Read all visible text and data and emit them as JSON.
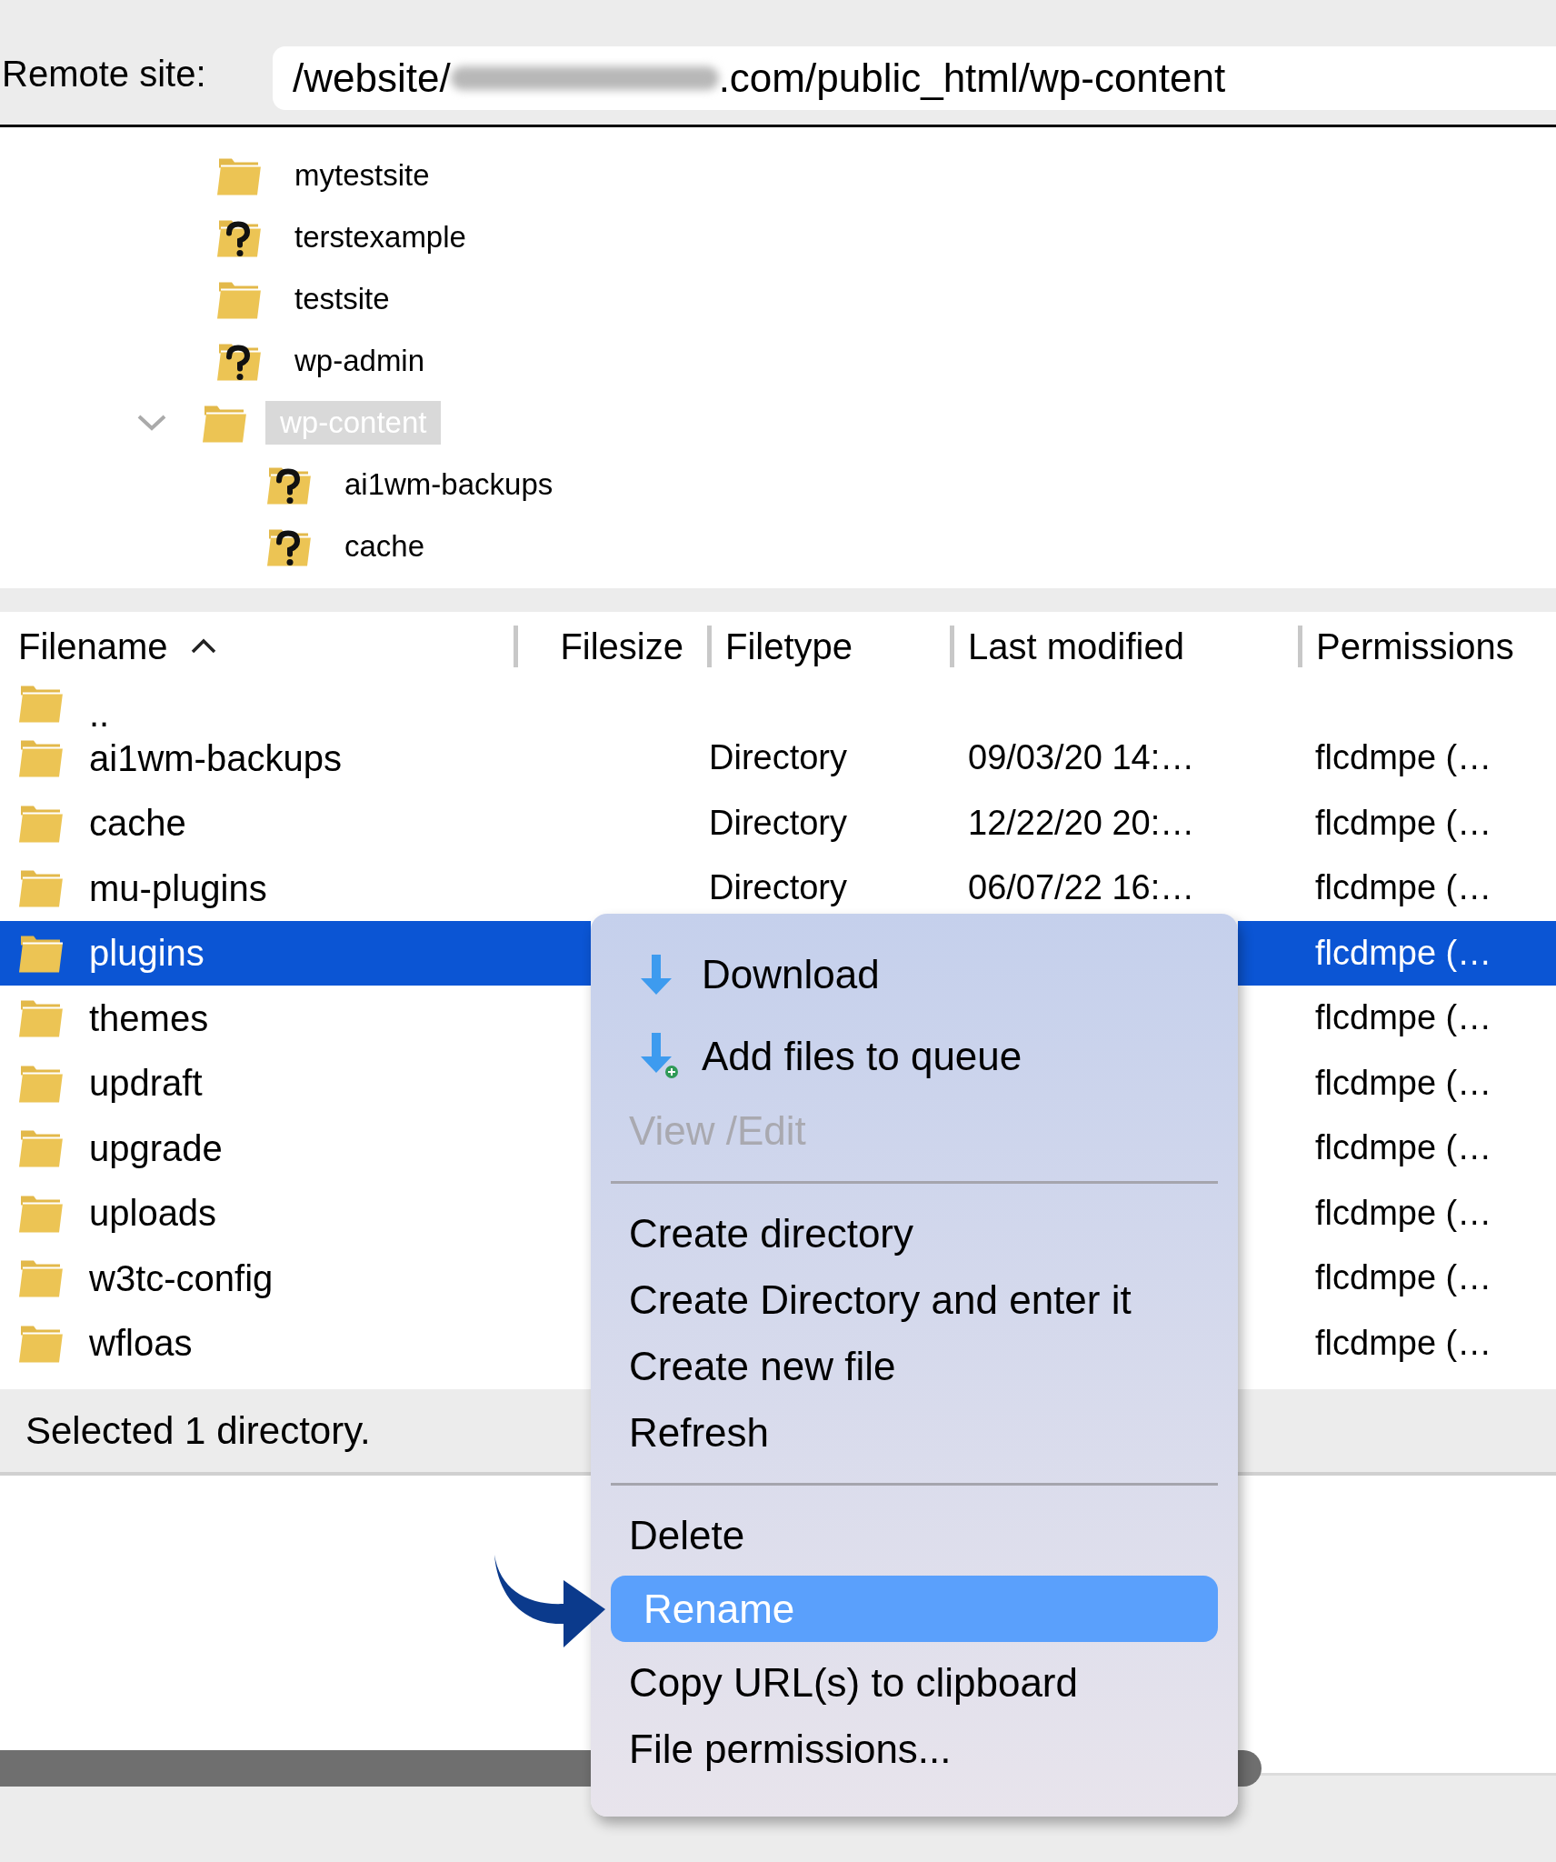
{
  "remote_site": {
    "label": "Remote site:",
    "path_start": "/website/",
    "path_end": ".com/public_html/wp-content"
  },
  "tree": [
    {
      "name": "mytestsite",
      "unknown": false,
      "selected": false
    },
    {
      "name": "terstexample",
      "unknown": true,
      "selected": false
    },
    {
      "name": "testsite",
      "unknown": false,
      "selected": false
    },
    {
      "name": "wp-admin",
      "unknown": true,
      "selected": false
    },
    {
      "name": "wp-content",
      "unknown": false,
      "selected": true,
      "expanded": true,
      "children": [
        {
          "name": "ai1wm-backups",
          "unknown": true,
          "selected": false
        },
        {
          "name": "cache",
          "unknown": true,
          "selected": false
        }
      ]
    }
  ],
  "file_list": {
    "columns": [
      {
        "label": "Filename",
        "sort_ascending": true
      },
      {
        "label": "Filesize"
      },
      {
        "label": "Filetype"
      },
      {
        "label": "Last modified"
      },
      {
        "label": "Permissions"
      }
    ],
    "rows": [
      {
        "name": "..",
        "selected": false
      },
      {
        "name": "ai1wm-backups",
        "filetype": "Directory",
        "last_modified": "09/03/20 14:…",
        "permissions": "flcdmpe (…",
        "selected": false
      },
      {
        "name": "cache",
        "filetype": "Directory",
        "last_modified": "12/22/20 20:…",
        "permissions": "flcdmpe (…",
        "selected": false
      },
      {
        "name": "mu-plugins",
        "filetype": "Directory",
        "last_modified": "06/07/22 16:…",
        "permissions": "flcdmpe (…",
        "selected": false
      },
      {
        "name": "plugins",
        "permissions": "flcdmpe (…",
        "selected": true
      },
      {
        "name": "themes",
        "permissions": "flcdmpe (…",
        "selected": false
      },
      {
        "name": "updraft",
        "permissions": "flcdmpe (…",
        "selected": false
      },
      {
        "name": "upgrade",
        "permissions": "flcdmpe (…",
        "selected": false
      },
      {
        "name": "uploads",
        "permissions": "flcdmpe (…",
        "selected": false
      },
      {
        "name": "w3tc-config",
        "permissions": "flcdmpe (…",
        "selected": false
      },
      {
        "name": "wfloas",
        "permissions": "flcdmpe (…",
        "selected": false
      }
    ]
  },
  "status_bar": {
    "text": "Selected 1 directory."
  },
  "context_menu": [
    {
      "kind": "download",
      "label": "Download",
      "disabled": false,
      "selected": false
    },
    {
      "kind": "queue",
      "label": "Add files to queue",
      "disabled": false,
      "selected": false
    },
    {
      "kind": "text",
      "label": "View /Edit",
      "disabled": true,
      "selected": false
    },
    {
      "kind": "separator"
    },
    {
      "kind": "text",
      "label": "Create directory",
      "disabled": false,
      "selected": false
    },
    {
      "kind": "text",
      "label": "Create Directory and enter it",
      "disabled": false,
      "selected": false
    },
    {
      "kind": "text",
      "label": "Create new file",
      "disabled": false,
      "selected": false
    },
    {
      "kind": "text",
      "label": "Refresh",
      "disabled": false,
      "selected": false
    },
    {
      "kind": "separator"
    },
    {
      "kind": "text",
      "label": "Delete",
      "disabled": false,
      "selected": false
    },
    {
      "kind": "text",
      "label": "Rename",
      "disabled": false,
      "selected": true
    },
    {
      "kind": "text",
      "label": "Copy URL(s) to clipboard",
      "disabled": false,
      "selected": false
    },
    {
      "kind": "text",
      "label": "File permissions...",
      "disabled": false,
      "selected": false
    }
  ]
}
